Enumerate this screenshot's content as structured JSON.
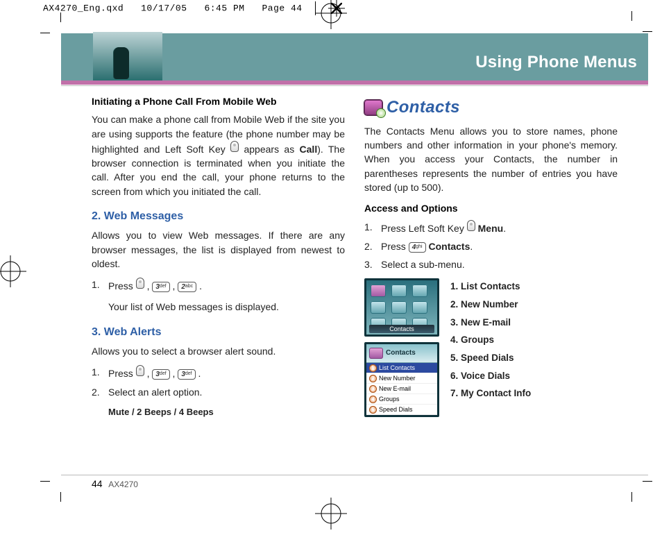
{
  "imposition": {
    "file": "AX4270_Eng.qxd",
    "date": "10/17/05",
    "time": "6:45 PM",
    "page_label": "Page 44"
  },
  "hero": {
    "title": "Using Phone Menus"
  },
  "left_col": {
    "h1": "Initiating a Phone Call From Mobile Web",
    "p1": "You can make a phone call from Mobile Web if the site you are using supports the feature (the phone number may be highlighted and Left Soft Key ",
    "p1_call": "Call",
    "p1_tail": "). The browser connection is terminated when you initiate the call. After you end the call, your phone returns to the screen from which you initiated the call.",
    "sec2": "2. Web Messages",
    "sec2_p": "Allows you to view Web messages. If there are any browser messages, the list is displayed from newest to oldest.",
    "sec2_step1_pre": "Press ",
    "sec2_step1_note": "Your list of Web messages is displayed.",
    "key3": "3 def",
    "key2": "2 abc",
    "sec3": "3. Web Alerts",
    "sec3_p": "Allows you to select a browser alert sound.",
    "sec3_step1_pre": "Press  ",
    "sec3_step2": "Select an alert option.",
    "sec3_options": "Mute / 2 Beeps / 4 Beeps"
  },
  "right_col": {
    "title": "Contacts",
    "intro": "The Contacts Menu allows you to store names, phone numbers and other information in your phone's memory. When you access your Contacts, the number in parentheses represents the number of entries you have stored (up to 500).",
    "h2": "Access and Options",
    "step1_pre": "Press Left Soft Key ",
    "step1_bold": "Menu",
    "step2_pre": "Press ",
    "step2_key": "4 ghi",
    "step2_bold": "Contacts",
    "step3": "Select a sub-menu.",
    "screen1_caption": "Contacts",
    "screen2_header": "Contacts",
    "screen2_rows": [
      "List Contacts",
      "New Number",
      "New E-mail",
      "Groups",
      "Speed Dials"
    ],
    "list": [
      "1. List Contacts",
      "2. New Number",
      "3. New E-mail",
      "4. Groups",
      "5. Speed Dials",
      "6. Voice Dials",
      "7. My Contact Info"
    ]
  },
  "footer": {
    "page": "44",
    "model": "AX4270"
  }
}
